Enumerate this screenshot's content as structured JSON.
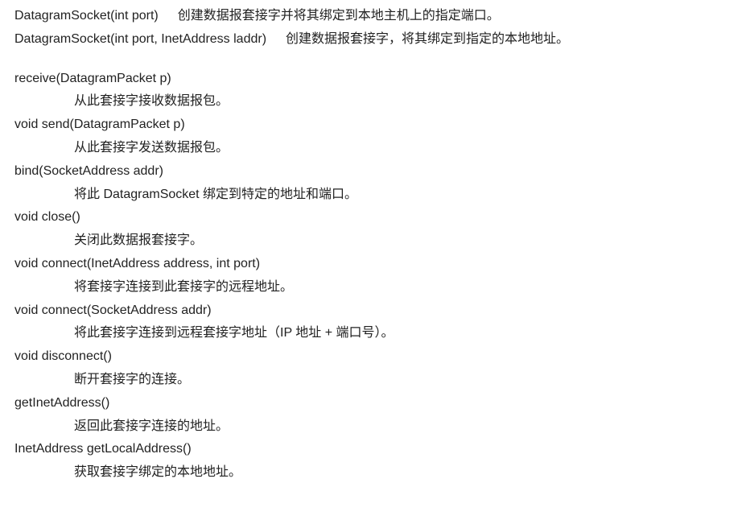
{
  "constructors": [
    {
      "sig": "DatagramSocket(int port)",
      "desc": "创建数据报套接字并将其绑定到本地主机上的指定端口。"
    },
    {
      "sig": "DatagramSocket(int port, InetAddress laddr)",
      "desc": "创建数据报套接字，将其绑定到指定的本地地址。"
    }
  ],
  "methods": [
    {
      "sig": "receive(DatagramPacket p)",
      "desc": "从此套接字接收数据报包。"
    },
    {
      "sig": "void send(DatagramPacket p)",
      "desc": "从此套接字发送数据报包。"
    },
    {
      "sig": "bind(SocketAddress addr)",
      "desc": "将此 DatagramSocket 绑定到特定的地址和端口。"
    },
    {
      "sig": "void close()",
      "desc": "关闭此数据报套接字。"
    },
    {
      "sig": "void connect(InetAddress address, int port)",
      "desc": "将套接字连接到此套接字的远程地址。"
    },
    {
      "sig": "void connect(SocketAddress addr)",
      "desc": "将此套接字连接到远程套接字地址（IP 地址 + 端口号）。"
    },
    {
      "sig": "void disconnect()",
      "desc": "断开套接字的连接。"
    },
    {
      "sig": "getInetAddress()",
      "desc": "返回此套接字连接的地址。"
    },
    {
      "sig": "InetAddress getLocalAddress()",
      "desc": "获取套接字绑定的本地地址。"
    }
  ]
}
